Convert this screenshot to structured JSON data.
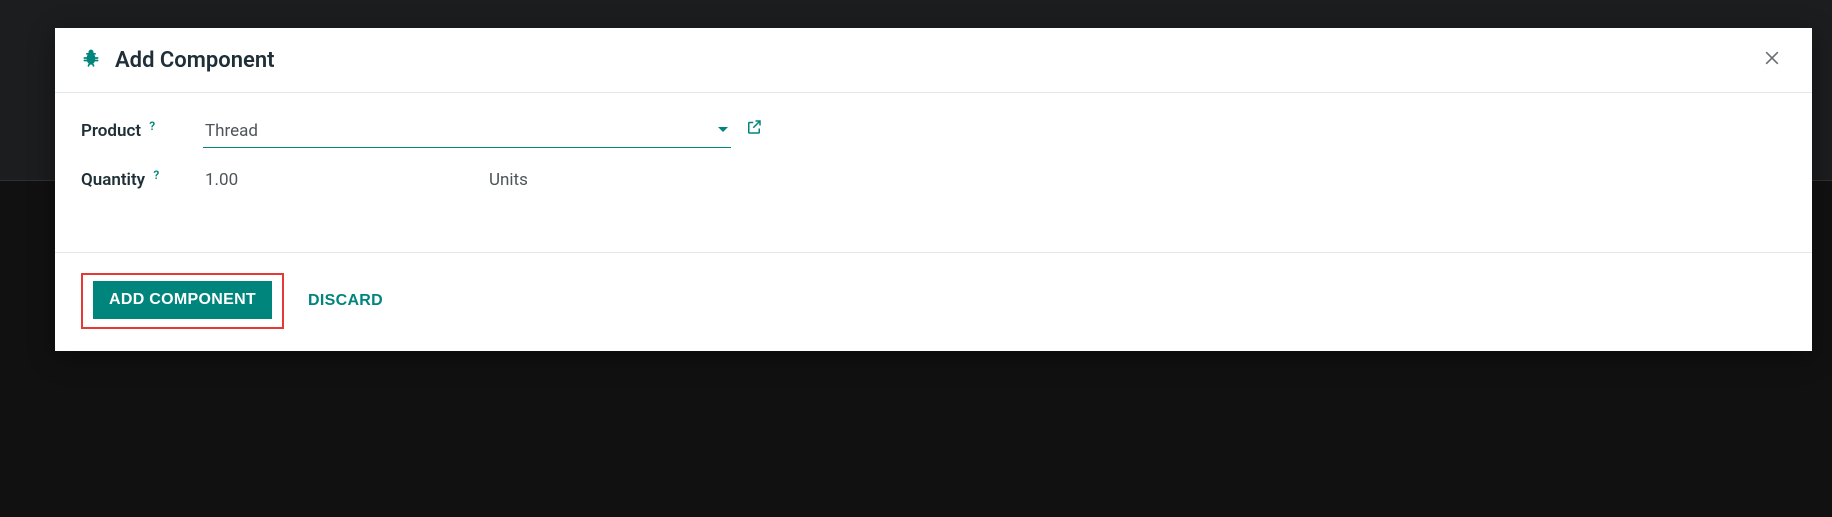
{
  "colors": {
    "accent": "#00857c",
    "highlight_border": "#e53935"
  },
  "modal": {
    "title": "Add Component",
    "fields": {
      "product": {
        "label": "Product",
        "value": "Thread"
      },
      "quantity": {
        "label": "Quantity",
        "value": "1.00",
        "uom": "Units"
      }
    },
    "footer": {
      "primary_label": "ADD COMPONENT",
      "discard_label": "DISCARD"
    }
  }
}
